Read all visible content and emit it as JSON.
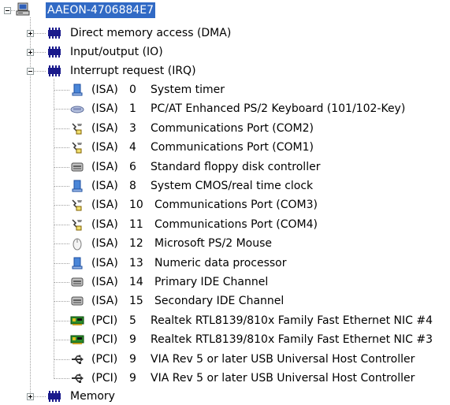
{
  "tree": {
    "root": {
      "label": "AAEON-4706884E7",
      "icon": "computer-icon",
      "selected": true
    },
    "categories": [
      {
        "label": "Direct memory access (DMA)",
        "icon": "chip-icon",
        "expanded": false
      },
      {
        "label": "Input/output (IO)",
        "icon": "chip-icon",
        "expanded": false
      },
      {
        "label": "Interrupt request (IRQ)",
        "icon": "chip-icon",
        "expanded": true
      },
      {
        "label": "Memory",
        "icon": "chip-icon",
        "expanded": false
      }
    ],
    "irq_items": [
      {
        "bus": "(ISA)",
        "irq": "0",
        "device": "System timer",
        "icon": "system-device-icon"
      },
      {
        "bus": "(ISA)",
        "irq": "1",
        "device": "PC/AT Enhanced PS/2 Keyboard (101/102-Key)",
        "icon": "keyboard-icon"
      },
      {
        "bus": "(ISA)",
        "irq": "3",
        "device": "Communications Port (COM2)",
        "icon": "serial-port-icon"
      },
      {
        "bus": "(ISA)",
        "irq": "4",
        "device": "Communications Port (COM1)",
        "icon": "serial-port-icon"
      },
      {
        "bus": "(ISA)",
        "irq": "6",
        "device": "Standard floppy disk controller",
        "icon": "disk-controller-icon"
      },
      {
        "bus": "(ISA)",
        "irq": "8",
        "device": "System CMOS/real time clock",
        "icon": "system-device-icon"
      },
      {
        "bus": "(ISA)",
        "irq": "10",
        "device": "Communications Port (COM3)",
        "icon": "serial-port-icon"
      },
      {
        "bus": "(ISA)",
        "irq": "11",
        "device": "Communications Port (COM4)",
        "icon": "serial-port-icon"
      },
      {
        "bus": "(ISA)",
        "irq": "12",
        "device": "Microsoft PS/2 Mouse",
        "icon": "mouse-icon"
      },
      {
        "bus": "(ISA)",
        "irq": "13",
        "device": "Numeric data processor",
        "icon": "system-device-icon"
      },
      {
        "bus": "(ISA)",
        "irq": "14",
        "device": "Primary IDE Channel",
        "icon": "disk-controller-icon"
      },
      {
        "bus": "(ISA)",
        "irq": "15",
        "device": "Secondary IDE Channel",
        "icon": "disk-controller-icon"
      },
      {
        "bus": "(PCI)",
        "irq": "5",
        "device": "Realtek RTL8139/810x Family Fast Ethernet NIC #4",
        "icon": "network-card-icon"
      },
      {
        "bus": "(PCI)",
        "irq": "9",
        "device": "Realtek RTL8139/810x Family Fast Ethernet NIC #3",
        "icon": "network-card-icon"
      },
      {
        "bus": "(PCI)",
        "irq": "9",
        "device": "VIA Rev 5 or later USB Universal Host Controller",
        "icon": "usb-icon"
      },
      {
        "bus": "(PCI)",
        "irq": "9",
        "device": "VIA Rev 5 or later USB Universal Host Controller",
        "icon": "usb-icon"
      }
    ],
    "colors": {
      "selection": "#316ac5",
      "chip": "#1a1a8c",
      "tree_line": "#a0a0a0"
    }
  }
}
